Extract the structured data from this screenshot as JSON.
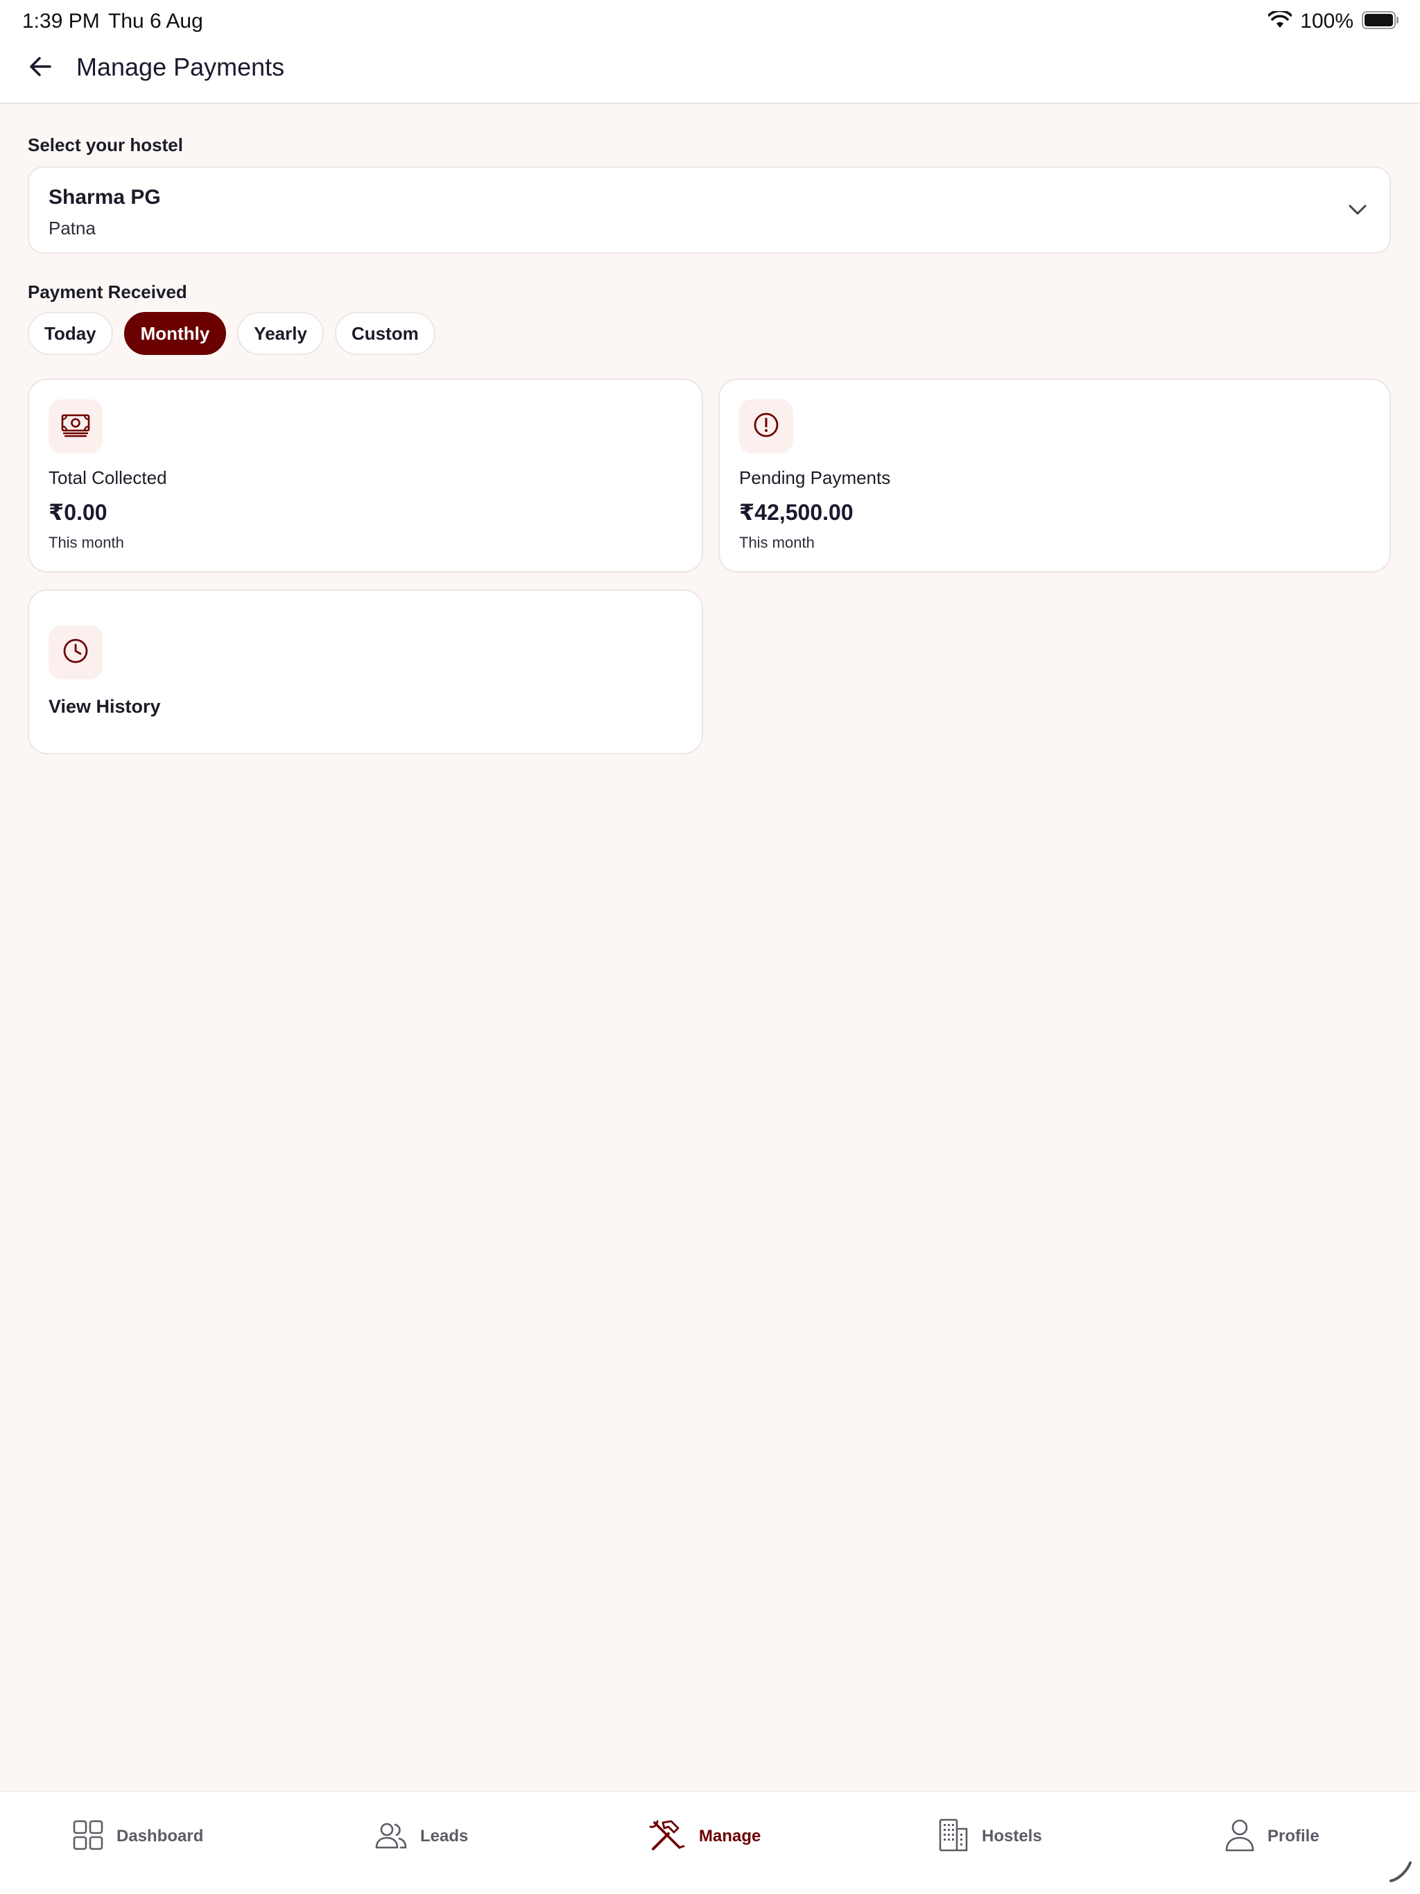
{
  "status_bar": {
    "time": "1:39 PM",
    "date": "Thu 6 Aug",
    "battery_percent": "100%",
    "icons": [
      "wifi-icon",
      "battery-icon"
    ]
  },
  "header": {
    "title": "Manage Payments",
    "back_icon": "arrow-left-icon"
  },
  "hostel_selector": {
    "label": "Select your hostel",
    "selected_name": "Sharma PG",
    "selected_city": "Patna",
    "icon": "chevron-down-icon"
  },
  "payment_received": {
    "label": "Payment Received",
    "filters": [
      {
        "label": "Today",
        "active": false
      },
      {
        "label": "Monthly",
        "active": true
      },
      {
        "label": "Yearly",
        "active": false
      },
      {
        "label": "Custom",
        "active": false
      }
    ]
  },
  "cards": {
    "total_collected": {
      "icon": "banknote-icon",
      "label": "Total Collected",
      "amount": "₹0.00",
      "sub": "This month"
    },
    "pending_payments": {
      "icon": "alert-circle-icon",
      "label": "Pending Payments",
      "amount": "₹42,500.00",
      "sub": "This month"
    },
    "view_history": {
      "icon": "clock-icon",
      "label": "View History"
    }
  },
  "bottom_nav": {
    "items": [
      {
        "label": "Dashboard",
        "icon": "grid-icon",
        "active": false
      },
      {
        "label": "Leads",
        "icon": "users-icon",
        "active": false
      },
      {
        "label": "Manage",
        "icon": "tools-icon",
        "active": true
      },
      {
        "label": "Hostels",
        "icon": "building-icon",
        "active": false
      },
      {
        "label": "Profile",
        "icon": "user-icon",
        "active": false
      }
    ]
  },
  "colors": {
    "accent": "#6b0000",
    "background": "#fcf7f5",
    "card": "#ffffff",
    "icon_bg": "#fbf0ee",
    "text": "#1c1c28",
    "muted": "#5c5c66"
  }
}
